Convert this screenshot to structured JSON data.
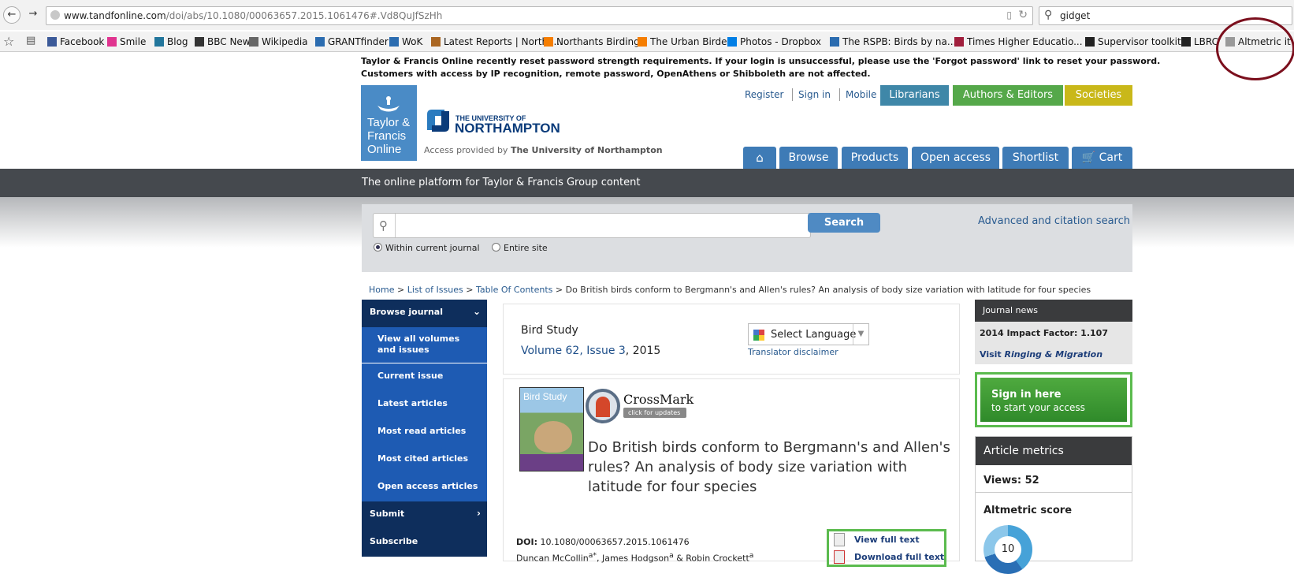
{
  "browser": {
    "url_host": "www.tandfonline.com",
    "url_path": "/doi/abs/10.1080/00063657.2015.1061476#.Vd8QuJfSzHh",
    "search_value": "gidget",
    "bookmarks": [
      {
        "label": "Facebook",
        "icon": "facebook-icon",
        "color": "#3b5998"
      },
      {
        "label": "Smile",
        "icon": "smile-icon",
        "color": "#e0338f"
      },
      {
        "label": "Blog",
        "icon": "wordpress-icon",
        "color": "#21759b"
      },
      {
        "label": "BBC News",
        "icon": "bbc-icon",
        "color": "#333333"
      },
      {
        "label": "Wikipedia",
        "icon": "wikipedia-icon",
        "color": "#666666"
      },
      {
        "label": "GRANTfinder",
        "icon": "grantfinder-icon",
        "color": "#2b6cb0"
      },
      {
        "label": "WoK",
        "icon": "wok-icon",
        "color": "#2b6cb0"
      },
      {
        "label": "Latest Reports | Northa...",
        "icon": "reports-icon",
        "color": "#aa6622"
      },
      {
        "label": "Northants Birding",
        "icon": "blogger-icon",
        "color": "#f57d00"
      },
      {
        "label": "The Urban Birder",
        "icon": "blogger-icon",
        "color": "#f57d00"
      },
      {
        "label": "Photos - Dropbox",
        "icon": "dropbox-icon",
        "color": "#007ee5"
      },
      {
        "label": "The RSPB: Birds by na...",
        "icon": "rspb-icon",
        "color": "#2b6cb0"
      },
      {
        "label": "Times Higher Educatio...",
        "icon": "the-icon",
        "color": "#a01e3c"
      },
      {
        "label": "Supervisor toolkit",
        "icon": "toolkit-icon",
        "color": "#222222"
      },
      {
        "label": "LBRC",
        "icon": "lbrc-icon",
        "color": "#222222"
      },
      {
        "label": "Altmetric it",
        "icon": "bookmark-icon",
        "color": "#999999"
      }
    ]
  },
  "notice": {
    "line1": "Taylor & Francis Online recently reset password strength requirements. If your login is unsuccessful, please use the 'Forgot password' link to reset your password.",
    "line2": "Customers with access by IP recognition, remote password, OpenAthens or Shibboleth are not affected."
  },
  "logo": {
    "line1": "Taylor &",
    "line2": "Francis",
    "line3": "Online",
    "uni_small": "THE UNIVERSITY OF",
    "uni_big": "NORTHAMPTON"
  },
  "access": {
    "prefix": "Access provided by",
    "institution": "The University of Northampton"
  },
  "top_links": {
    "register": "Register",
    "signin": "Sign in",
    "mobile": "Mobile"
  },
  "color_tabs": {
    "librarians": "Librarians",
    "authors": "Authors & Editors",
    "societies": "Societies",
    "librarians_color": "#3f87a8",
    "authors_color": "#55a84a",
    "societies_color": "#c9b81a"
  },
  "nav_tabs": {
    "browse": "Browse",
    "products": "Products",
    "open_access": "Open access",
    "shortlist": "Shortlist",
    "cart": "Cart"
  },
  "platform_tagline": "The online platform for Taylor & Francis Group content",
  "search": {
    "button": "Search",
    "advanced": "Advanced and citation search",
    "radio_current": "Within current journal",
    "radio_site": "Entire site"
  },
  "breadcrumb": {
    "home": "Home",
    "issues": "List of Issues",
    "toc": "Table Of Contents",
    "current": "Do British birds conform to Bergmann's and Allen's rules? An analysis of body size variation with latitude for four species"
  },
  "left_nav": {
    "browse_journal": "Browse journal",
    "view_all": "View all volumes and issues",
    "current_issue": "Current issue",
    "latest": "Latest articles",
    "most_read": "Most read articles",
    "most_cited": "Most cited articles",
    "open_access": "Open access articles",
    "submit": "Submit",
    "subscribe": "Subscribe"
  },
  "journal": {
    "name": "Bird Study",
    "volume": "Volume 62, Issue 3",
    "year": ", 2015",
    "select_language": "Select Language",
    "translator": "Translator disclaimer"
  },
  "article": {
    "cover_title": "Bird Study",
    "crossmark": "CrossMark",
    "crossmark_sub": "click for updates",
    "title": "Do British birds conform to Bergmann's and Allen's rules? An analysis of body size variation with latitude for four species",
    "doi_label": "DOI:",
    "doi_value": "10.1080/00063657.2015.1061476",
    "author1": "Duncan McCollin",
    "author1_sup": "a*",
    "sep1": ", ",
    "author2": "James Hodgson",
    "author2_sup": "a",
    "sep2": " & ",
    "author3": "Robin Crockett",
    "author3_sup": "a",
    "view_full": "View full text",
    "download_full": "Download full text"
  },
  "right": {
    "journal_news": "Journal news",
    "impact": "2014 Impact Factor: 1.107",
    "visit_prefix": "Visit ",
    "visit_journal": "Ringing & Migration",
    "sign_l1": "Sign in here",
    "sign_l2": "to start your access",
    "metrics_title": "Article metrics",
    "views": "Views: 52",
    "altmetric": "Altmetric score",
    "altmetric_value": "10"
  }
}
